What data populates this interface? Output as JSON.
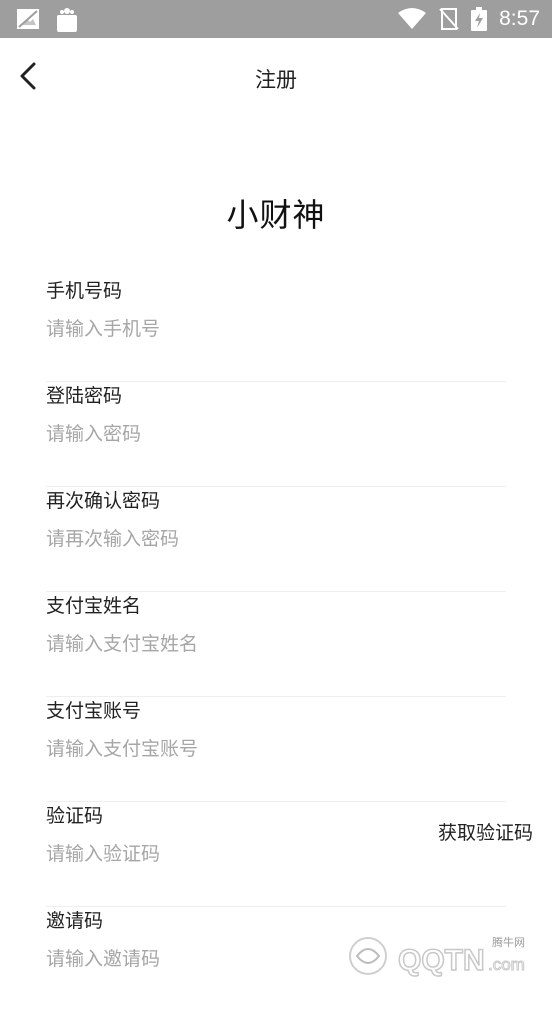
{
  "status_bar": {
    "time": "8:57",
    "icons": [
      "image-notification-icon",
      "shopping-bag-icon",
      "wifi-icon",
      "no-sim-icon",
      "battery-charging-icon"
    ]
  },
  "header": {
    "back_icon": "chevron-left-icon",
    "title": "注册"
  },
  "brand": {
    "name": "小财神"
  },
  "form": {
    "fields": [
      {
        "label": "手机号码",
        "placeholder": "请输入手机号",
        "value": ""
      },
      {
        "label": "登陆密码",
        "placeholder": "请输入密码",
        "value": ""
      },
      {
        "label": "再次确认密码",
        "placeholder": "请再次输入密码",
        "value": ""
      },
      {
        "label": "支付宝姓名",
        "placeholder": "请输入支付宝姓名",
        "value": ""
      },
      {
        "label": "支付宝账号",
        "placeholder": "请输入支付宝账号",
        "value": ""
      },
      {
        "label": "验证码",
        "placeholder": "请输入验证码",
        "value": ""
      },
      {
        "label": "邀请码",
        "placeholder": "请输入邀请码",
        "value": ""
      }
    ],
    "get_code_label": "获取验证码"
  },
  "watermark": {
    "text": "QQTN.com",
    "small_text": "腾牛网"
  },
  "colors": {
    "status_bar_bg": "#9e9e9e",
    "placeholder": "#a6a6a6",
    "divider": "#eeeeee",
    "text": "#222222"
  }
}
